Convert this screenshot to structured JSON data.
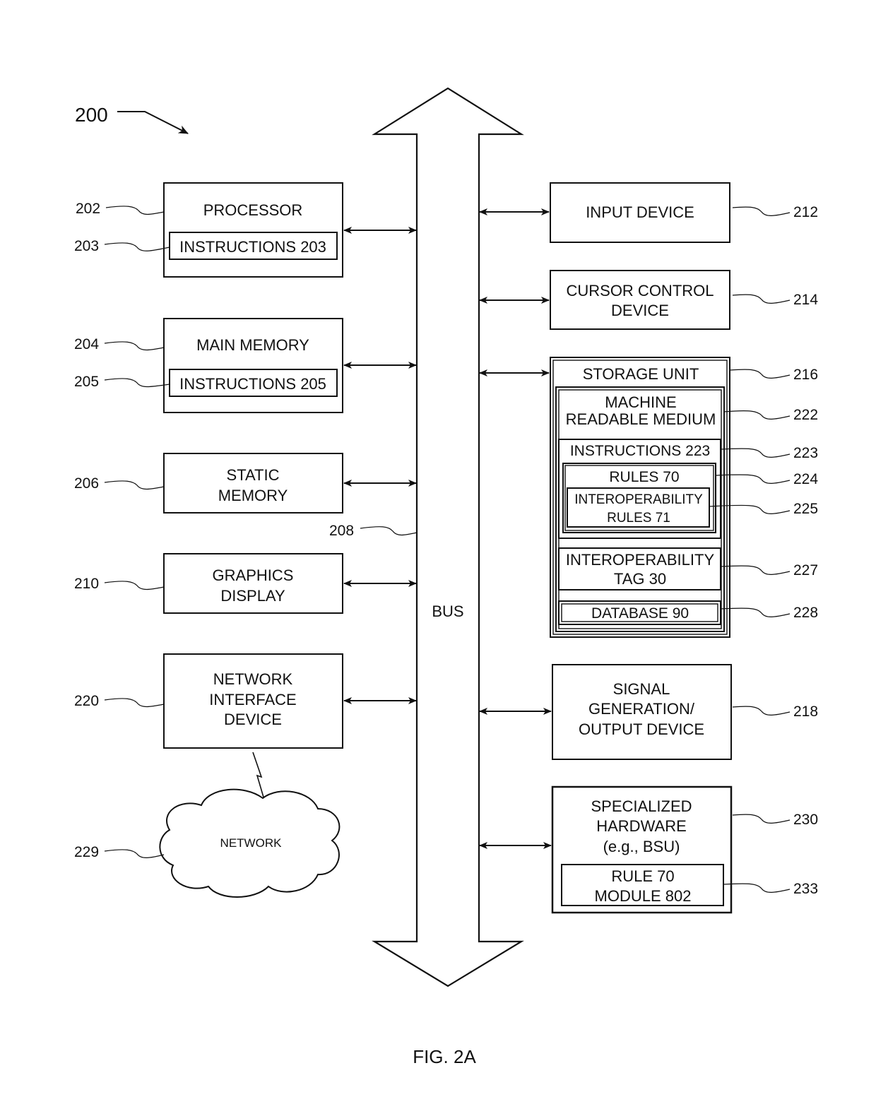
{
  "figure": {
    "id": "200",
    "caption": "FIG. 2A"
  },
  "bus": {
    "label": "BUS",
    "ref": "208"
  },
  "left_components": [
    {
      "id": "processor",
      "ref": "202",
      "lines": [
        "PROCESSOR"
      ],
      "inner": {
        "ref": "203",
        "lines": [
          "INSTRUCTIONS 203"
        ]
      }
    },
    {
      "id": "main-memory",
      "ref": "204",
      "lines": [
        "MAIN MEMORY"
      ],
      "inner": {
        "ref": "205",
        "lines": [
          "INSTRUCTIONS 205"
        ]
      }
    },
    {
      "id": "static-memory",
      "ref": "206",
      "lines": [
        "STATIC",
        "MEMORY"
      ]
    },
    {
      "id": "graphics-display",
      "ref": "210",
      "lines": [
        "GRAPHICS",
        "DISPLAY"
      ]
    },
    {
      "id": "network-interface-device",
      "ref": "220",
      "lines": [
        "NETWORK",
        "INTERFACE",
        "DEVICE"
      ]
    }
  ],
  "network": {
    "ref": "229",
    "label": "NETWORK"
  },
  "right_components": [
    {
      "id": "input-device",
      "ref": "212",
      "lines": [
        "INPUT DEVICE"
      ]
    },
    {
      "id": "cursor-control-device",
      "ref": "214",
      "lines": [
        "CURSOR CONTROL",
        "DEVICE"
      ]
    },
    {
      "id": "signal-generation-output-device",
      "ref": "218",
      "lines": [
        "SIGNAL",
        "GENERATION/",
        "OUTPUT DEVICE"
      ]
    }
  ],
  "storage_unit": {
    "ref": "216",
    "label": "STORAGE UNIT",
    "machine_readable_medium": {
      "ref": "222",
      "lines": [
        "MACHINE",
        "READABLE MEDIUM"
      ],
      "instructions": {
        "ref": "223",
        "label": "INSTRUCTIONS 223",
        "rules": {
          "ref": "224",
          "label": "RULES 70",
          "interoperability_rules": {
            "ref": "225",
            "lines": [
              "INTEROPERABILITY",
              "RULES 71"
            ]
          }
        }
      },
      "interoperability_tag": {
        "ref": "227",
        "lines": [
          "INTEROPERABILITY",
          "TAG 30"
        ]
      },
      "database": {
        "ref": "228",
        "label": "DATABASE 90"
      }
    }
  },
  "specialized_hardware": {
    "ref": "230",
    "lines": [
      "SPECIALIZED",
      "HARDWARE",
      "(e.g., BSU)"
    ],
    "module": {
      "ref": "233",
      "lines": [
        "RULE 70",
        "MODULE 802"
      ]
    }
  }
}
